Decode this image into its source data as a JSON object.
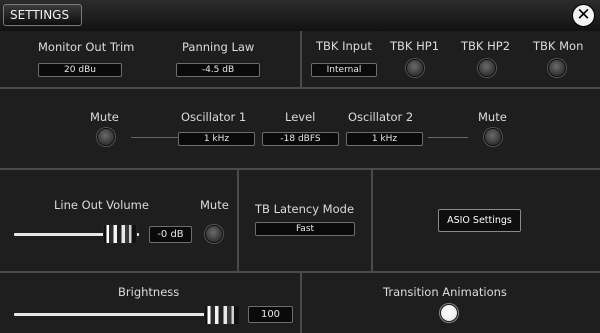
{
  "window": {
    "title": "SETTINGS",
    "close_glyph": "✕"
  },
  "monitor": {
    "trim_label": "Monitor Out Trim",
    "trim_value": "20 dBu",
    "panning_label": "Panning Law",
    "panning_value": "-4.5 dB"
  },
  "tbk": {
    "input_label": "TBK Input",
    "input_value": "Internal",
    "hp1_label": "TBK HP1",
    "hp2_label": "TBK HP2",
    "mon_label": "TBK Mon"
  },
  "oscillator": {
    "mute_left_label": "Mute",
    "osc1_label": "Oscillator 1",
    "osc1_value": "1 kHz",
    "level_label": "Level",
    "level_value": "-18 dBFS",
    "osc2_label": "Oscillator 2",
    "osc2_value": "1 kHz",
    "mute_right_label": "Mute"
  },
  "line_out": {
    "volume_label": "Line Out Volume",
    "volume_value": "-0 dB",
    "mute_label": "Mute"
  },
  "latency": {
    "label": "TB Latency Mode",
    "value": "Fast"
  },
  "asio": {
    "button_label": "ASIO Settings"
  },
  "brightness": {
    "label": "Brightness",
    "value": "100"
  },
  "transitions": {
    "label": "Transition Animations",
    "enabled": true
  }
}
